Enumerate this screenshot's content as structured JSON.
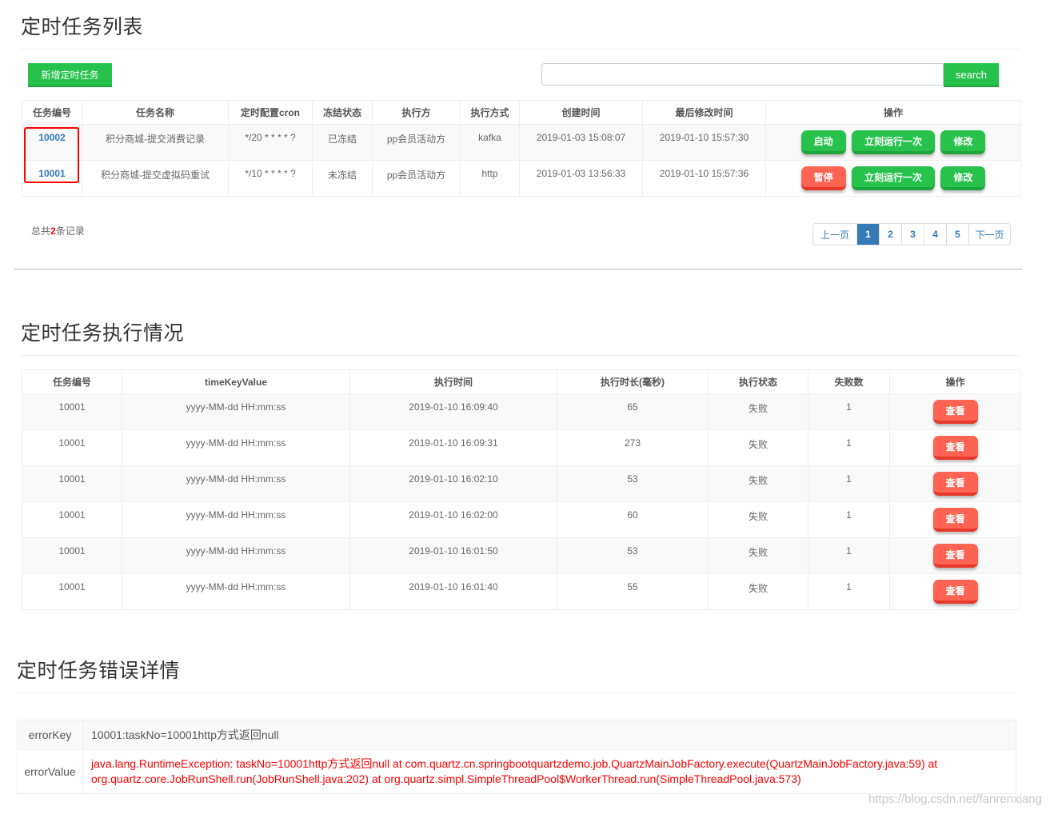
{
  "task_list": {
    "title": "定时任务列表",
    "add_button": "新增定时任务",
    "search": {
      "placeholder": "",
      "value": "",
      "button": "search"
    },
    "columns": [
      "任务编号",
      "任务名称",
      "定时配置cron",
      "冻结状态",
      "执行方",
      "执行方式",
      "创建时间",
      "最后修改时间",
      "操作"
    ],
    "rows": [
      {
        "id": "10002",
        "name": "积分商城-提交消费记录",
        "cron": "*/20 * * * * ?",
        "frozen": "已冻结",
        "executor": "pp会员活动方",
        "method": "kafka",
        "created": "2019-01-03 15:08:07",
        "modified": "2019-01-10 15:57:30",
        "toggle": "启动",
        "run_once": "立刻运行一次",
        "edit": "修改"
      },
      {
        "id": "10001",
        "name": "积分商城-提交虚拟码重试",
        "cron": "*/10 * * * * ?",
        "frozen": "未冻结",
        "executor": "pp会员活动方",
        "method": "http",
        "created": "2019-01-03 13:56:33",
        "modified": "2019-01-10 15:57:36",
        "toggle": "暂停",
        "run_once": "立刻运行一次",
        "edit": "修改"
      }
    ],
    "total": {
      "prefix": "总共",
      "count": "2",
      "suffix": "条记录"
    },
    "pagination": {
      "prev": "上一页",
      "pages": [
        "1",
        "2",
        "3",
        "4",
        "5"
      ],
      "current": "1",
      "next": "下一页"
    }
  },
  "execution": {
    "title": "定时任务执行情况",
    "columns": [
      "任务编号",
      "timeKeyValue",
      "执行时间",
      "执行时长(毫秒)",
      "执行状态",
      "失败数",
      "操作"
    ],
    "rows": [
      {
        "id": "10001",
        "time_key": "yyyy-MM-dd HH:mm:ss",
        "exec_time": "2019-01-10 16:09:40",
        "duration": "65",
        "status": "失败",
        "fail_count": "1",
        "action": "查看"
      },
      {
        "id": "10001",
        "time_key": "yyyy-MM-dd HH:mm:ss",
        "exec_time": "2019-01-10 16:09:31",
        "duration": "273",
        "status": "失败",
        "fail_count": "1",
        "action": "查看"
      },
      {
        "id": "10001",
        "time_key": "yyyy-MM-dd HH:mm:ss",
        "exec_time": "2019-01-10 16:02:10",
        "duration": "53",
        "status": "失败",
        "fail_count": "1",
        "action": "查看"
      },
      {
        "id": "10001",
        "time_key": "yyyy-MM-dd HH:mm:ss",
        "exec_time": "2019-01-10 16:02:00",
        "duration": "60",
        "status": "失败",
        "fail_count": "1",
        "action": "查看"
      },
      {
        "id": "10001",
        "time_key": "yyyy-MM-dd HH:mm:ss",
        "exec_time": "2019-01-10 16:01:50",
        "duration": "53",
        "status": "失败",
        "fail_count": "1",
        "action": "查看"
      },
      {
        "id": "10001",
        "time_key": "yyyy-MM-dd HH:mm:ss",
        "exec_time": "2019-01-10 16:01:40",
        "duration": "55",
        "status": "失败",
        "fail_count": "1",
        "action": "查看"
      }
    ]
  },
  "error_detail": {
    "title": "定时任务错误详情",
    "key_label": "errorKey",
    "key_value": "10001:taskNo=10001http方式返回null",
    "value_label": "errorValue",
    "value_line1": "java.lang.RuntimeException: taskNo=10001http方式返回null at com.quartz.cn.springbootquartzdemo.job.QuartzMainJobFactory.execute(QuartzMainJobFactory.java:59) at",
    "value_line2": "org.quartz.core.JobRunShell.run(JobRunShell.java:202) at org.quartz.simpl.SimpleThreadPool$WorkerThread.run(SimpleThreadPool.java:573)"
  },
  "watermark": "https://blog.csdn.net/fanrenxiang",
  "colors": {
    "green": "#27c24c",
    "red": "#ff6354",
    "blue": "#337ab7",
    "error_red": "#ff0000"
  }
}
